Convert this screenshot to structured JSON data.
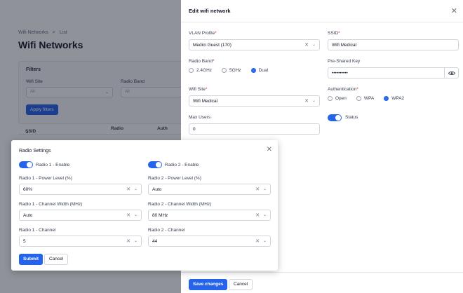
{
  "background": {
    "breadcrumb": [
      "Wifi Networks",
      "List"
    ],
    "breadcrumb_sep": ">",
    "title": "Wifi Networks",
    "filters": {
      "title": "Filters",
      "wifi_site_label": "Wifi Site",
      "wifi_site_value": "All",
      "radio_band_label": "Radio Band",
      "radio_band_value": "All",
      "apply_label": "Apply filters"
    },
    "table_headers": [
      "SSID",
      "Radio",
      "Auth"
    ]
  },
  "drawer": {
    "title": "Edit wifi network",
    "vlan_profile": {
      "label": "VLAN Profile",
      "value": "Medici Guest (170)"
    },
    "ssid": {
      "label": "SSID",
      "value": "Wifi Medical"
    },
    "radio_band": {
      "label": "Radio Band",
      "options": [
        "2.4GHz",
        "5GHz",
        "Dual"
      ],
      "selected": "Dual"
    },
    "psk": {
      "label": "Pre-Shared Key",
      "value": "••••••••••"
    },
    "wifi_site": {
      "label": "Wifi Site",
      "value": "Wifi Medical"
    },
    "authentication": {
      "label": "Authentication",
      "options": [
        "Open",
        "WPA",
        "WPA2"
      ],
      "selected": "WPA2"
    },
    "max_users": {
      "label": "Max Users",
      "value": "0"
    },
    "status": {
      "label": "Status",
      "on": true
    },
    "save_label": "Save changes",
    "cancel_label": "Cancel"
  },
  "modal": {
    "title": "Radio Settings",
    "radio1_enable": {
      "label": "Radio 1 - Enable",
      "on": true
    },
    "radio2_enable": {
      "label": "Radio 2 - Enable",
      "on": true
    },
    "radio1_power": {
      "label": "Radio 1 - Power Level (%)",
      "value": "60%"
    },
    "radio2_power": {
      "label": "Radio 2 - Power Level (%)",
      "value": "Auto"
    },
    "radio1_width": {
      "label": "Radio 1 - Channel Width (MHz)",
      "value": "Auto"
    },
    "radio2_width": {
      "label": "Radio 2 - Channel Width (MHz)",
      "value": "80 MHz"
    },
    "radio1_channel": {
      "label": "Radio 1 - Channel",
      "value": "5"
    },
    "radio2_channel": {
      "label": "Radio 2 - Channel",
      "value": "44"
    },
    "submit_label": "Submit",
    "cancel_label": "Cancel"
  },
  "colors": {
    "accent": "#2563eb",
    "required": "#dc2626"
  },
  "icons": {
    "close": "close-icon",
    "clear": "clear-icon",
    "chevron": "chevron-down-icon",
    "eye": "eye-icon"
  }
}
